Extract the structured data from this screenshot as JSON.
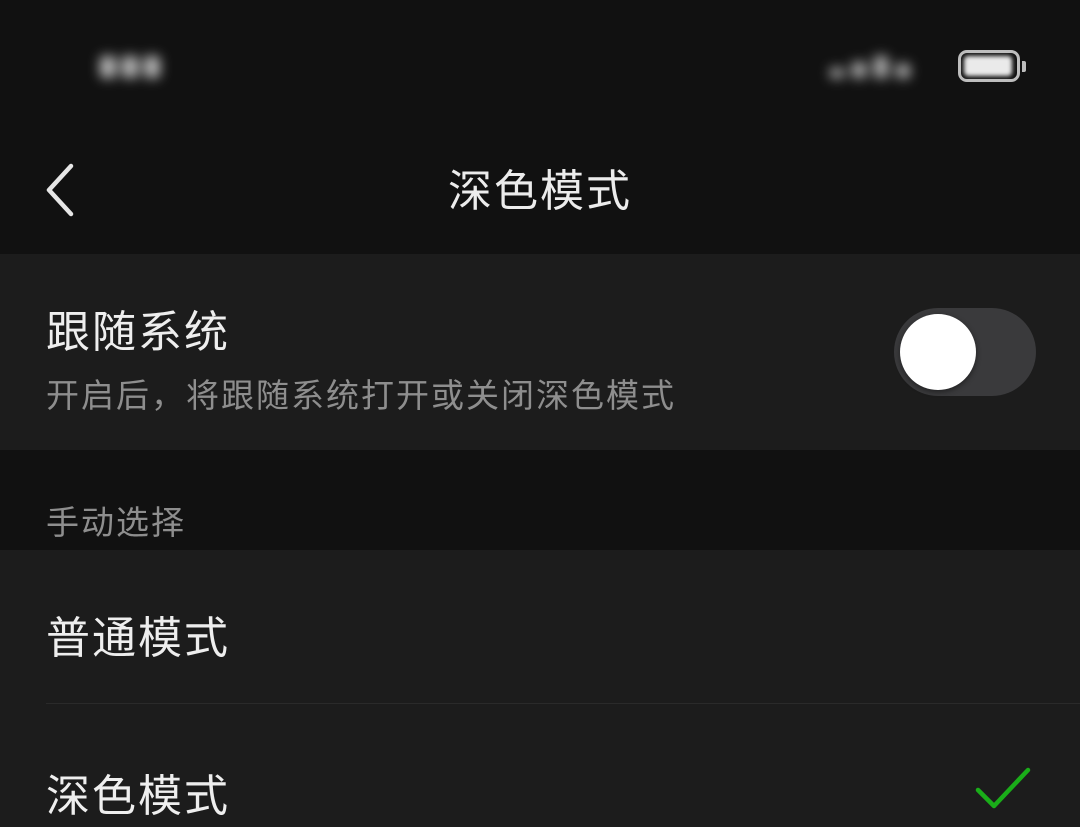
{
  "nav": {
    "title": "深色模式",
    "back_icon": "chevron-left-icon"
  },
  "follow_system": {
    "title": "跟随系统",
    "description": "开启后，将跟随系统打开或关闭深色模式",
    "toggle_on": false
  },
  "manual": {
    "section_label": "手动选择",
    "options": [
      {
        "label": "普通模式",
        "selected": false
      },
      {
        "label": "深色模式",
        "selected": true
      }
    ]
  },
  "colors": {
    "background": "#111111",
    "card": "#1c1c1c",
    "check_accent": "#1aad19",
    "toggle_off_track": "#3a3a3c"
  }
}
